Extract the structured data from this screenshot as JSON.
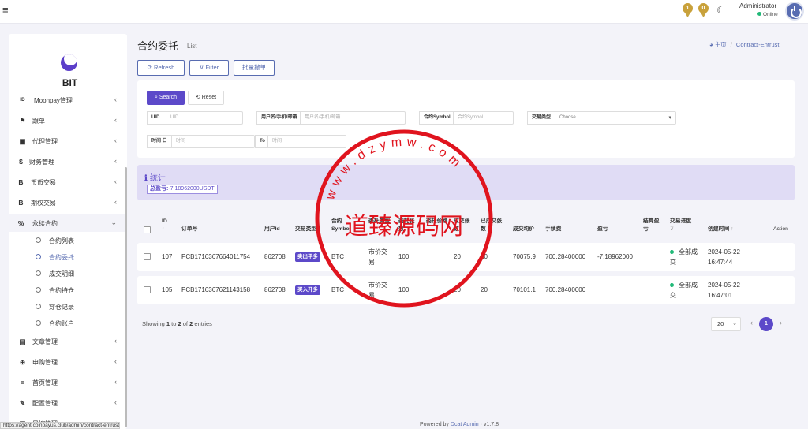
{
  "topbar": {
    "menu_icon": "hamburger-icon",
    "medal_1": "1",
    "medal_2": "0",
    "theme_icon": "moon-icon",
    "admin_name": "Administrator",
    "admin_status": "Online"
  },
  "sidebar": {
    "logo_text": "BIT",
    "items": [
      {
        "icon": "ID",
        "label": "Moonpay管理",
        "chevron": "‹"
      },
      {
        "icon": "⚑",
        "label": "跟单",
        "chevron": "‹"
      },
      {
        "icon": "▣",
        "label": "代理管理",
        "chevron": "‹"
      },
      {
        "icon": "$",
        "label": "财务管理",
        "chevron": "‹"
      },
      {
        "icon": "B",
        "label": "币币交易",
        "chevron": "‹"
      },
      {
        "icon": "B",
        "label": "期权交易",
        "chevron": "‹"
      },
      {
        "icon": "%",
        "label": "永续合约",
        "chevron": "⌄"
      },
      {
        "icon": "▤",
        "label": "文章管理",
        "chevron": "‹"
      },
      {
        "icon": "⊕",
        "label": "申购管理",
        "chevron": "‹"
      },
      {
        "icon": "≡",
        "label": "首页管理",
        "chevron": "‹"
      },
      {
        "icon": "✎",
        "label": "配置管理",
        "chevron": "‹"
      },
      {
        "icon": "▦",
        "label": "风控管理",
        "chevron": "‹"
      }
    ],
    "sub_items": [
      {
        "label": "合约列表"
      },
      {
        "label": "合约委托"
      },
      {
        "label": "成交明细"
      },
      {
        "label": "合约持仓"
      },
      {
        "label": "穿仓记录"
      },
      {
        "label": "合约账户"
      }
    ]
  },
  "header": {
    "title": "合约委托",
    "subtitle": "List",
    "breadcrumb_home": "主页",
    "breadcrumb_sep": "/",
    "breadcrumb_current": "Contract-Entrust"
  },
  "toolbar": {
    "refresh_label": "⟳ Refresh",
    "filter_label": "⊽ Filter",
    "batch_cancel_label": "批量撤单"
  },
  "filter": {
    "search_label": "⌕ Search",
    "reset_label": "⟲ Reset",
    "uid_label": "UID",
    "uid_placeholder": "UID",
    "user_label": "用户名/手机/邮箱",
    "user_placeholder": "用户名/手机/邮箱",
    "symbol_label": "合约Symbol",
    "symbol_placeholder": "合约Symbol",
    "type_label": "交易类型",
    "type_value": "Choose",
    "type_arrow": "▾",
    "time_label": "时间 日",
    "time_from_placeholder": "时间",
    "time_to_label": "To",
    "time_to_placeholder": "时间"
  },
  "stats": {
    "title_icon": "ℹ",
    "title": "统计",
    "profit_label": "总盈亏:",
    "profit_value": "-7.18962000USDT"
  },
  "table": {
    "columns": {
      "id": "ID",
      "id_sort": "↑",
      "order_no": "订单号",
      "user_id": "用户Id",
      "trade_type_1": "交易类",
      "trade_type_2": "型",
      "symbol_1": "合约",
      "symbol_2": "Symbol",
      "order_type": "委托类型",
      "lots_1": "委托张",
      "lots_2": "数",
      "price": "委托价格",
      "filled_lots_1": "成交张",
      "filled_lots_2": "数",
      "filled_1": "已成交张",
      "filled_2": "数",
      "avg_price": "成交均价",
      "fee": "手续费",
      "profit": "盈亏",
      "settle_1": "结算盈",
      "settle_2": "亏",
      "progress_1": "交易进度",
      "progress_filter": "⊽",
      "created": "创建时间",
      "created_sort": "↑",
      "action": "Action"
    },
    "rows": [
      {
        "id": "107",
        "order_no": "PCB1716367664011754",
        "user_id": "862708",
        "trade_type": "卖出平多",
        "symbol": "BTC",
        "order_type_1": "市价交",
        "order_type_2": "易",
        "lots": "100",
        "filled_lots": "20",
        "filled": "20",
        "avg_price": "70075.9",
        "fee": "700.28400000",
        "profit": "-7.18962000",
        "status_1": "全部成",
        "status_2": "交",
        "created_date": "2024-05-22",
        "created_time": "16:47:44"
      },
      {
        "id": "105",
        "order_no": "PCB1716367621143158",
        "user_id": "862708",
        "trade_type": "买入开多",
        "symbol": "BTC",
        "order_type_1": "市价交",
        "order_type_2": "易",
        "lots": "100",
        "filled_lots": "20",
        "filled": "20",
        "avg_price": "70101.1",
        "fee": "700.28400000",
        "profit": "",
        "status_1": "全部成",
        "status_2": "交",
        "created_date": "2024-05-22",
        "created_time": "16:47:01"
      }
    ]
  },
  "pagination": {
    "showing_prefix": "Showing",
    "from": "1",
    "to_word": "to",
    "to": "2",
    "of_word": "of",
    "total": "2",
    "entries_word": "entries",
    "per_page": "20",
    "per_page_arrow": "⌄",
    "prev": "‹",
    "current": "1",
    "next": "›"
  },
  "footer": {
    "powered_by": "Powered by",
    "brand": "Dcat Admin",
    "sep": "·",
    "version": "v1.7.8"
  },
  "status_bar_url": "https://agent.coinpayus.club/admin/contract-entrust",
  "watermark": {
    "center_text": "道臻源码网",
    "ring_text": "www.dzymw.com"
  },
  "colors": {
    "accent": "#586cb1",
    "primary": "#5c49c9",
    "success": "#21b978",
    "stamp": "#e0141e"
  }
}
